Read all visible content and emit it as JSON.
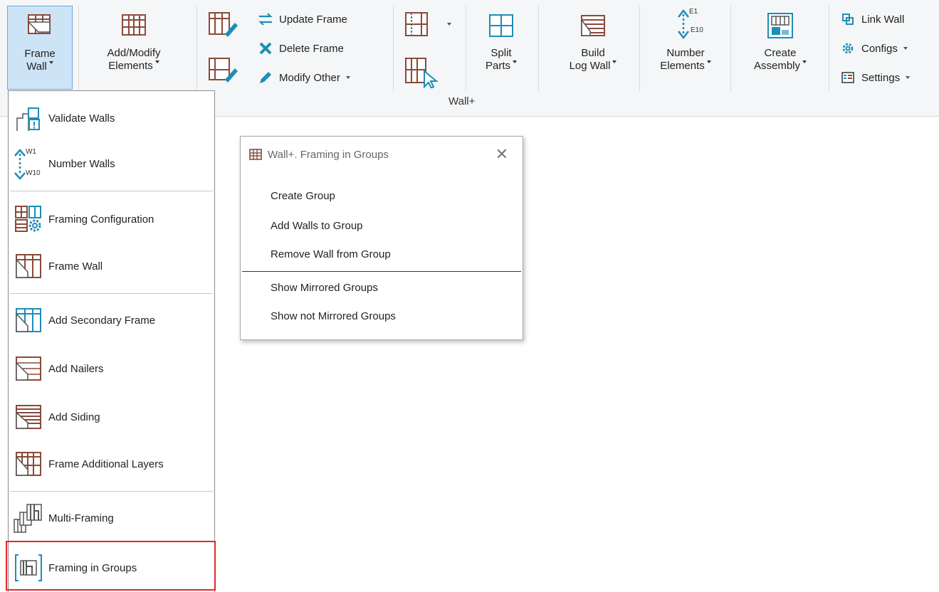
{
  "ribbon": {
    "frame_wall": {
      "line1": "Frame",
      "line2": "Wall"
    },
    "add_modify": {
      "line1": "Add/Modify",
      "line2": "Elements"
    },
    "update_frame": "Update Frame",
    "delete_frame": "Delete Frame",
    "modify_other": "Modify Other",
    "split_parts": {
      "line1": "Split",
      "line2": "Parts"
    },
    "build_log_wall": {
      "line1": "Build",
      "line2": "Log Wall"
    },
    "number_elements": {
      "line1": "Number",
      "line2": "Elements",
      "icon_top": "E1",
      "icon_bottom": "E10"
    },
    "create_assembly": {
      "line1": "Create",
      "line2": "Assembly"
    },
    "link_wall": "Link Wall",
    "configs": "Configs",
    "settings": "Settings",
    "group_label": "Wall+"
  },
  "menu": {
    "items": [
      {
        "label": "Validate Walls",
        "icon": "validate-walls-icon"
      },
      {
        "label": "Number Walls",
        "icon": "number-walls-icon",
        "icon_top": "W1",
        "icon_bottom": "W10"
      },
      {
        "label": "Framing Configuration",
        "icon": "framing-configuration-icon"
      },
      {
        "label": "Frame Wall",
        "icon": "frame-wall-icon"
      },
      {
        "label": "Add Secondary Frame",
        "icon": "secondary-frame-icon"
      },
      {
        "label": "Add Nailers",
        "icon": "nailers-icon"
      },
      {
        "label": "Add Siding",
        "icon": "siding-icon"
      },
      {
        "label": "Frame Additional Layers",
        "icon": "additional-layers-icon"
      },
      {
        "label": "Multi-Framing",
        "icon": "multi-framing-icon"
      },
      {
        "label": "Framing in Groups",
        "icon": "framing-groups-icon"
      }
    ]
  },
  "dialog": {
    "title": "Wall+. Framing in Groups",
    "items": [
      "Create Group",
      "Add Walls to Group",
      "Remove Wall from Group",
      "Show Mirrored Groups",
      "Show not Mirrored Groups"
    ]
  },
  "colors": {
    "icon_brown": "#8a4a3a",
    "icon_blue": "#1e8db8",
    "selected_bg": "#cde4f7",
    "highlight_red": "#e8242a"
  }
}
